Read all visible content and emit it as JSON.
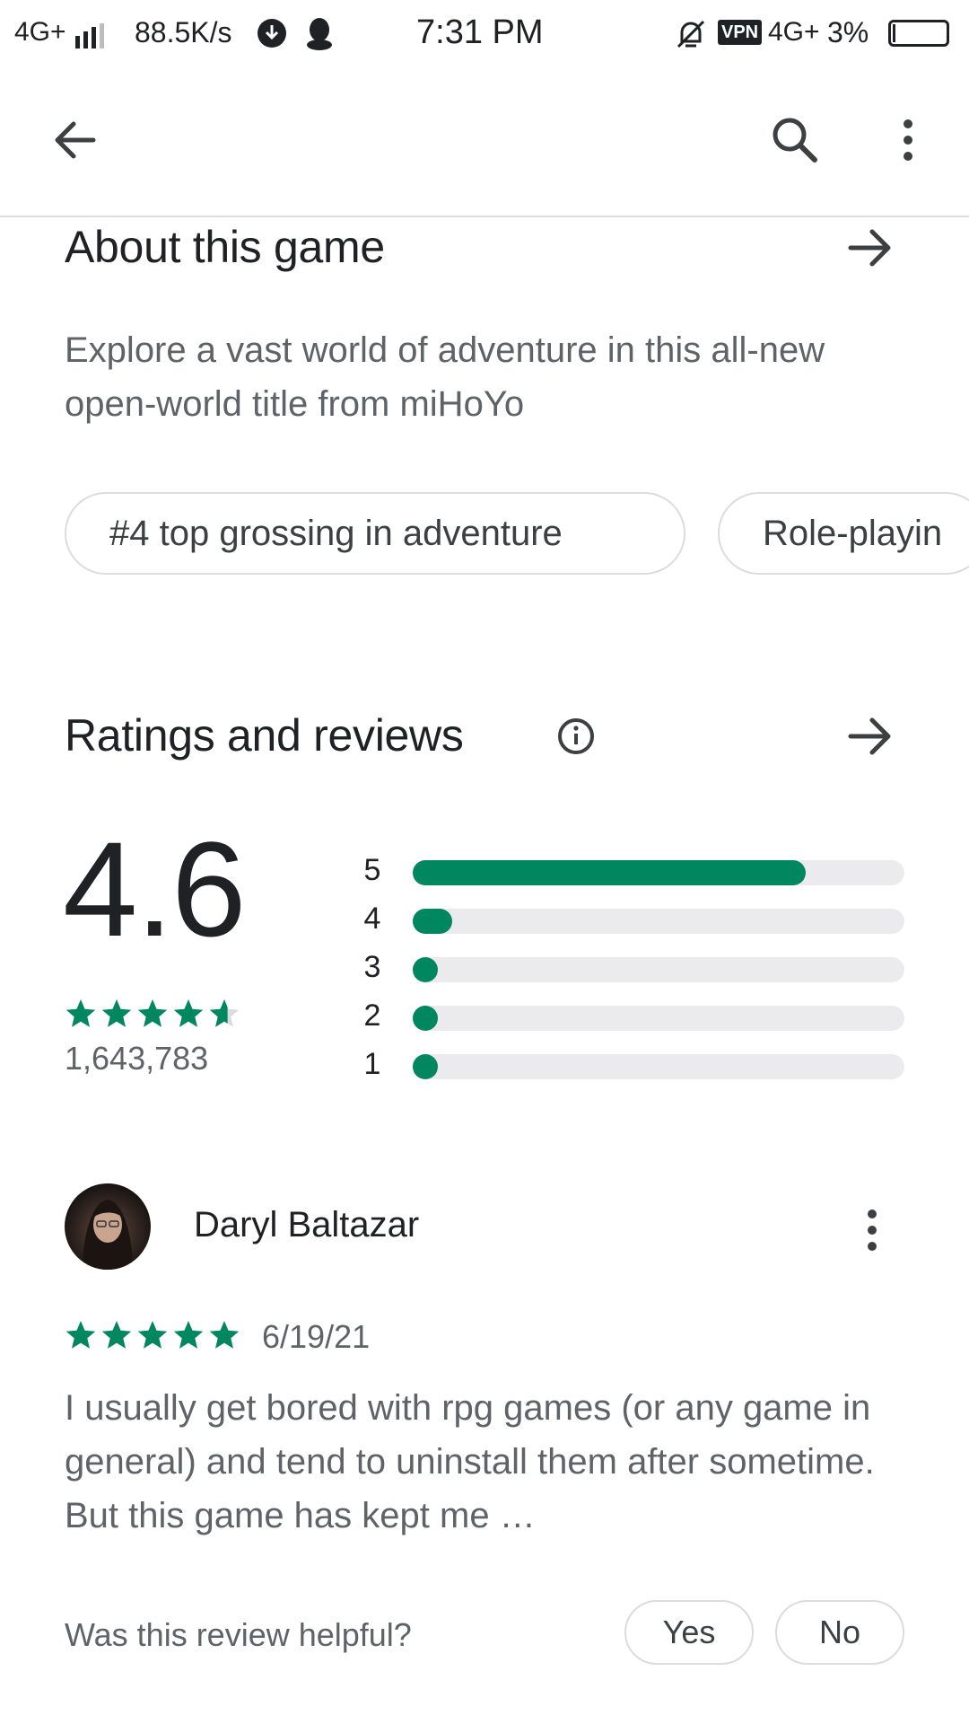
{
  "status_bar": {
    "network_left": "4G+",
    "speed": "88.5K/s",
    "time": "7:31 PM",
    "vpn": "VPN",
    "network_right": "4G+",
    "battery": "3%"
  },
  "about": {
    "title": "About this game",
    "description": "Explore a vast world of adventure in this all-new open-world title from miHoYo",
    "chips": [
      "#4 top grossing in adventure",
      "Role-playin"
    ]
  },
  "ratings": {
    "title": "Ratings and reviews",
    "average": "4.6",
    "stars_filled": 4.6,
    "count": "1,643,783",
    "distribution": [
      {
        "label": "5",
        "fraction": 0.8
      },
      {
        "label": "4",
        "fraction": 0.08
      },
      {
        "label": "3",
        "fraction": 0.05
      },
      {
        "label": "2",
        "fraction": 0.05
      },
      {
        "label": "1",
        "fraction": 0.05
      }
    ],
    "accent_color": "#01875f"
  },
  "review": {
    "author": "Daryl Baltazar",
    "stars": 5,
    "date": "6/19/21",
    "text": "I usually get bored with rpg games (or any game in general) and tend to uninstall them after sometime. But this game has kept me …",
    "helpful_prompt": "Was this review helpful?",
    "yes_label": "Yes",
    "no_label": "No"
  },
  "icons": {
    "back": "arrow-left-icon",
    "search": "search-icon",
    "more": "more-vert-icon",
    "info": "info-icon",
    "forward": "arrow-right-icon"
  }
}
